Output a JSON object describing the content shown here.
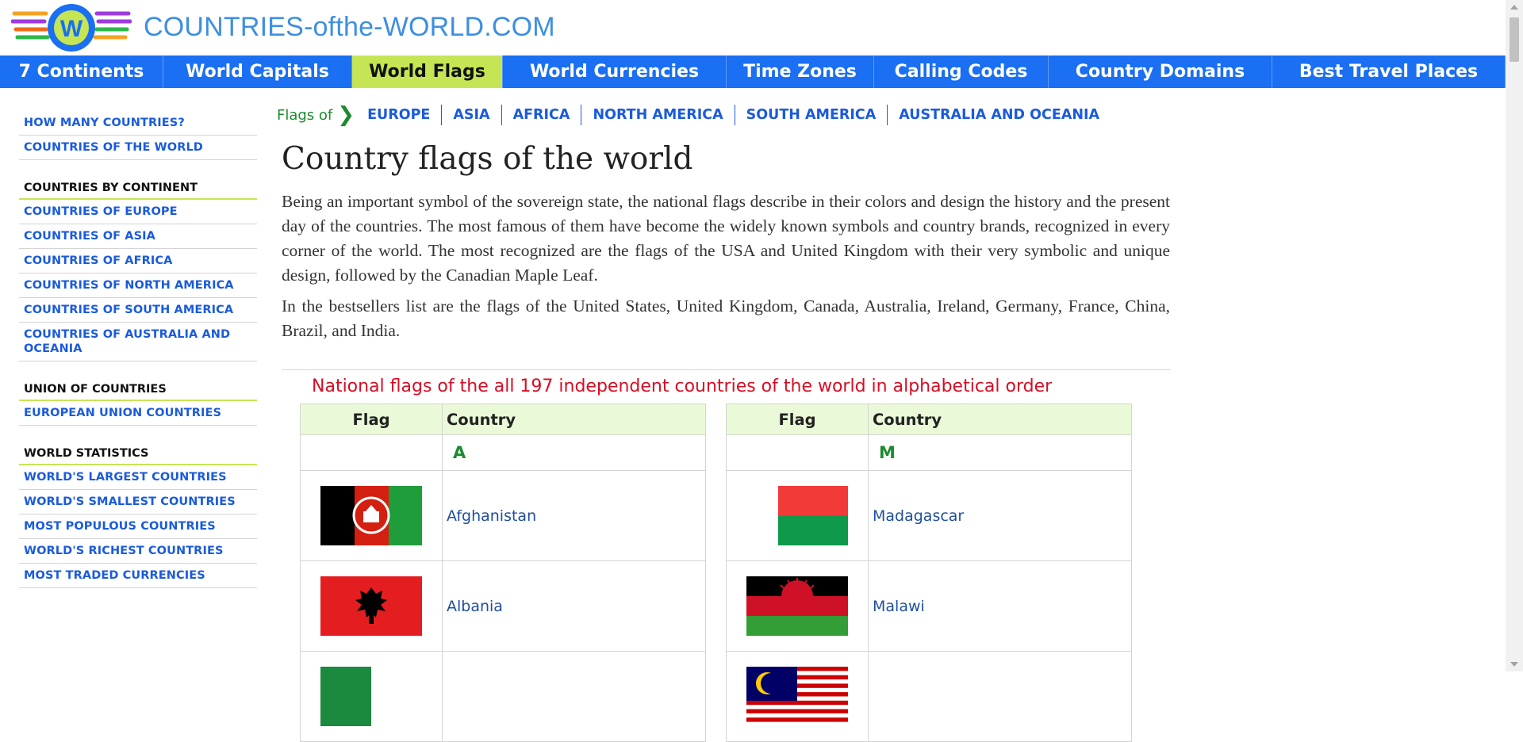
{
  "site": {
    "title": "COUNTRIES-ofthe-WORLD.COM"
  },
  "nav": [
    {
      "label": "7 Continents",
      "width": 206,
      "active": false
    },
    {
      "label": "World Capitals",
      "width": 238,
      "active": false
    },
    {
      "label": "World Flags",
      "width": 190,
      "active": true
    },
    {
      "label": "World Currencies",
      "width": 282,
      "active": false
    },
    {
      "label": "Time Zones",
      "width": 186,
      "active": false
    },
    {
      "label": "Calling Codes",
      "width": 220,
      "active": false
    },
    {
      "label": "Country Domains",
      "width": 282,
      "active": false
    },
    {
      "label": "Best Travel Places",
      "width": 294,
      "active": false
    }
  ],
  "sidebar": {
    "top_links": [
      "HOW MANY COUNTRIES?",
      "COUNTRIES OF THE WORLD"
    ],
    "sections": [
      {
        "heading": "COUNTRIES BY CONTINENT",
        "links": [
          "COUNTRIES OF EUROPE",
          "COUNTRIES OF ASIA",
          "COUNTRIES OF AFRICA",
          "COUNTRIES OF NORTH AMERICA",
          "COUNTRIES OF SOUTH AMERICA",
          "COUNTRIES OF AUSTRALIA AND OCEANIA"
        ]
      },
      {
        "heading": "UNION OF COUNTRIES",
        "links": [
          "EUROPEAN UNION COUNTRIES"
        ]
      },
      {
        "heading": "WORLD STATISTICS",
        "links": [
          "WORLD'S LARGEST COUNTRIES",
          "WORLD'S SMALLEST COUNTRIES",
          "MOST POPULOUS COUNTRIES",
          "WORLD'S RICHEST COUNTRIES",
          "MOST TRADED CURRENCIES"
        ]
      }
    ]
  },
  "breadcrumb": {
    "label": "Flags of",
    "links": [
      "EUROPE",
      "ASIA",
      "AFRICA",
      "NORTH AMERICA",
      "SOUTH AMERICA",
      "AUSTRALIA AND OCEANIA"
    ]
  },
  "main": {
    "heading": "Country flags of the world",
    "paragraph1": "Being an important symbol of the sovereign state, the national flags describe in their colors and design the history and the present day of the countries. The most famous of them have become the widely known symbols and country brands, recognized in every corner of the world. The most recognized are the flags of the USA and United Kingdom with their very symbolic and unique design, followed by the Canadian Maple Leaf.",
    "paragraph2": "In the bestsellers list are the flags of the United States, United Kingdom, Canada, Australia, Ireland, Germany, France, China, Brazil, and India.",
    "list_title": "National flags of the all 197 independent countries of the world in alphabetical order"
  },
  "tables": {
    "col_flag": "Flag",
    "col_country": "Country",
    "left": {
      "letter": "A",
      "countries": [
        "Afghanistan",
        "Albania"
      ]
    },
    "right": {
      "letter": "M",
      "countries": [
        "Madagascar",
        "Malawi"
      ]
    }
  }
}
